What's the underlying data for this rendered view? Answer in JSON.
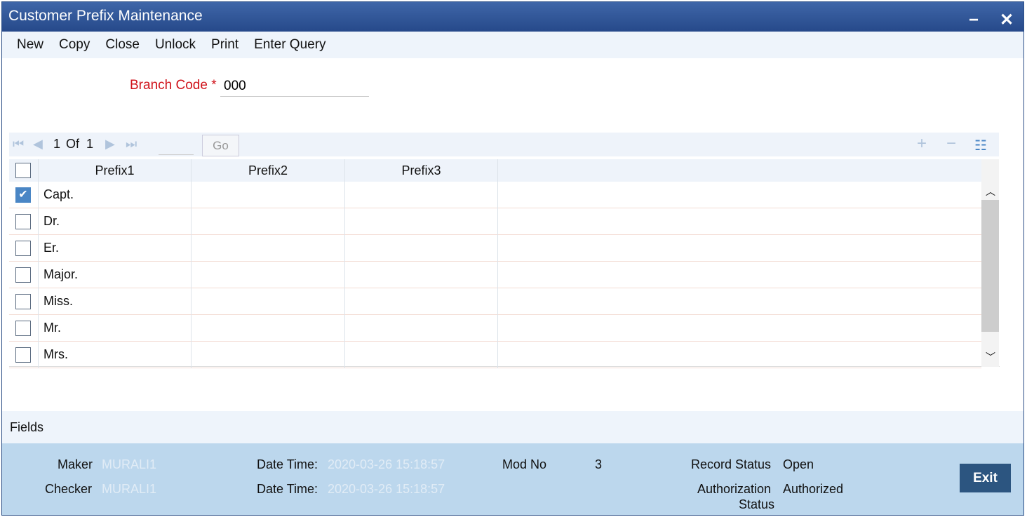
{
  "window": {
    "title": "Customer Prefix Maintenance",
    "minimize": "−",
    "close": "✕"
  },
  "toolbar": [
    "New",
    "Copy",
    "Close",
    "Unlock",
    "Print",
    "Enter Query"
  ],
  "branch": {
    "label": "Branch Code",
    "required": "*",
    "value": "000"
  },
  "pager": {
    "current": "1",
    "of": "Of",
    "total": "1",
    "go": "Go",
    "add": "+",
    "remove": "−",
    "menu": "☷"
  },
  "grid": {
    "columns": [
      "Prefix1",
      "Prefix2",
      "Prefix3"
    ],
    "rows": [
      {
        "p1": "Capt.",
        "checked": true
      },
      {
        "p1": "Dr.",
        "checked": false
      },
      {
        "p1": "Er.",
        "checked": false
      },
      {
        "p1": "Major.",
        "checked": false
      },
      {
        "p1": "Miss.",
        "checked": false
      },
      {
        "p1": "Mr.",
        "checked": false
      },
      {
        "p1": "Mrs.",
        "checked": false
      }
    ]
  },
  "fields_label": "Fields",
  "footer": {
    "maker_label": "Maker",
    "maker": "MURALI1",
    "checker_label": "Checker",
    "checker": "MURALI1",
    "dt_label": "Date Time:",
    "maker_dt": "2020-03-26 15:18:57",
    "checker_dt": "2020-03-26 15:18:57",
    "mod_label": "Mod No",
    "mod": "3",
    "rs_label": "Record Status",
    "rs": "Open",
    "auth_label1": "Authorization",
    "auth_label2": "Status",
    "auth": "Authorized",
    "exit": "Exit"
  }
}
